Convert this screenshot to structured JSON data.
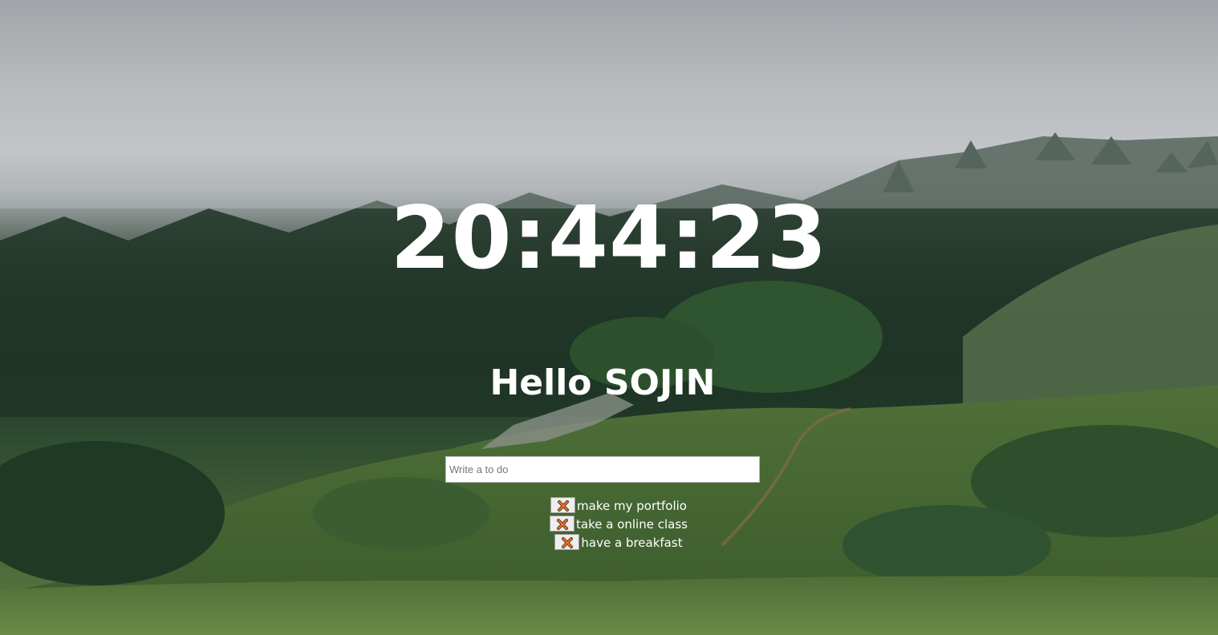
{
  "clock": {
    "time": "20:44:23"
  },
  "greeting": {
    "text": "Hello SOJIN"
  },
  "todo": {
    "placeholder": "Write a to do",
    "value": "",
    "items": [
      {
        "text": "make my portfolio",
        "delete_icon": "cross-mark-icon"
      },
      {
        "text": "take a online class",
        "delete_icon": "cross-mark-icon"
      },
      {
        "text": "have a breakfast",
        "delete_icon": "cross-mark-icon"
      }
    ]
  },
  "background": {
    "image": "misty-forest-hills"
  }
}
